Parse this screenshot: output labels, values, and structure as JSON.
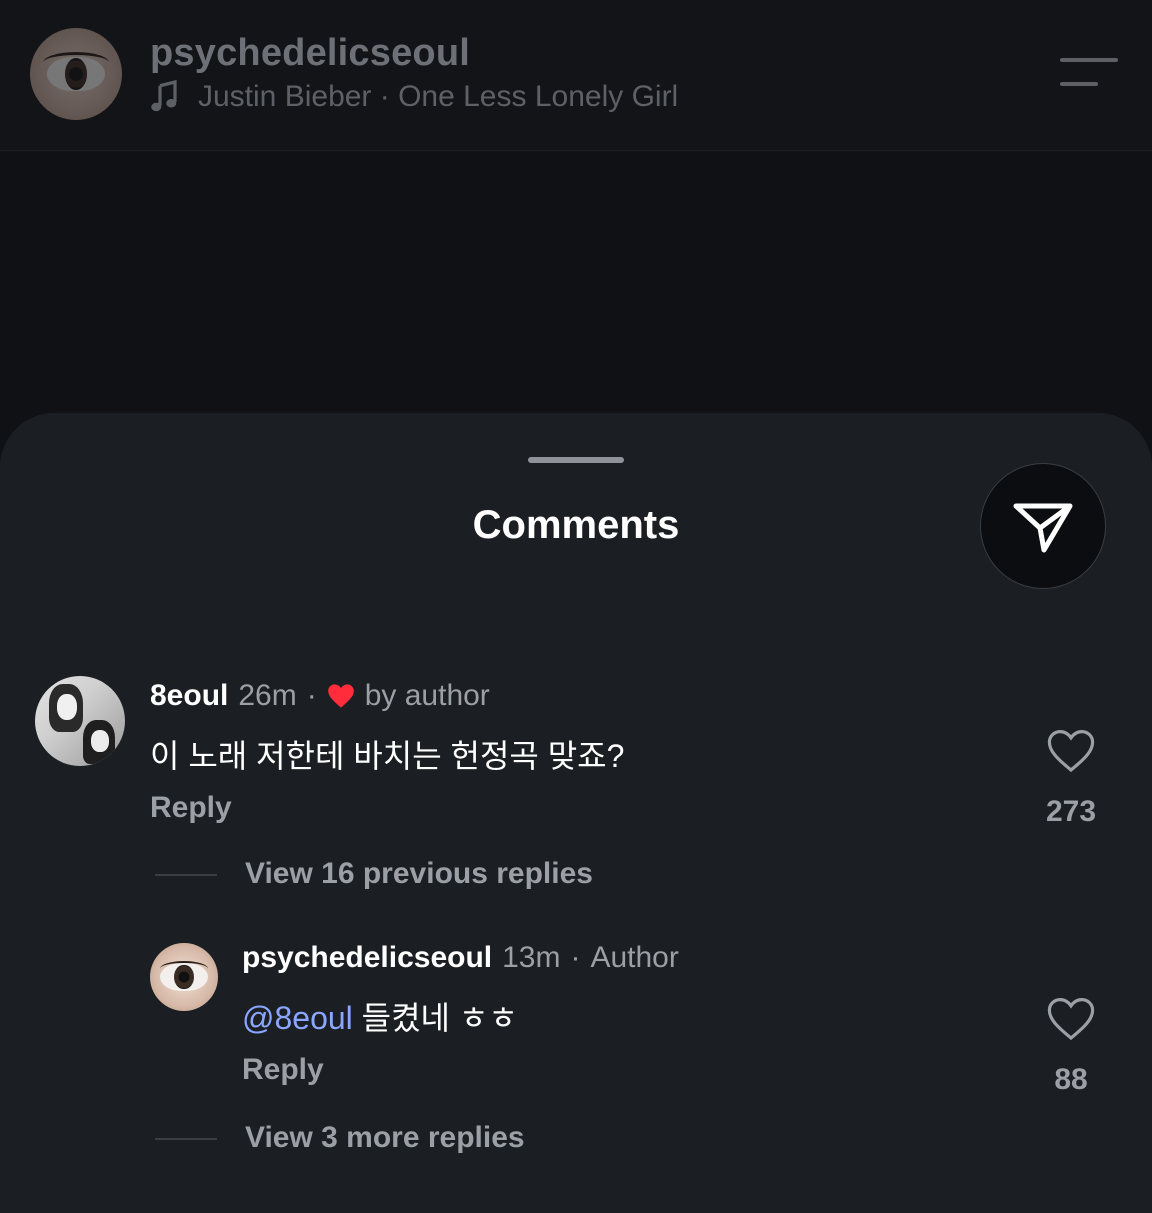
{
  "header": {
    "username": "psychedelicseoul",
    "song": "Justin Bieber · One Less Lonely Girl",
    "avatar_icon": "eye-avatar-icon",
    "music_icon": "music-note-icon",
    "menu_icon": "hamburger-menu-icon"
  },
  "sheet": {
    "title": "Comments",
    "share_icon": "send-icon"
  },
  "comments": [
    {
      "username": "8eoul",
      "time": "26m",
      "liked_by": "by author",
      "text": "이 노래 저한테 바치는 헌정곡 맞죠?",
      "reply_label": "Reply",
      "likes": "273",
      "view_replies": "View 16 previous replies"
    },
    {
      "username": "psychedelicseoul",
      "time": "13m",
      "badge": "Author",
      "mention": "@8eoul",
      "text": " 들켰네 ㅎㅎ",
      "reply_label": "Reply",
      "likes": "88",
      "view_replies": "View 3 more replies"
    }
  ],
  "colors": {
    "background": "#0f1114",
    "sheet": "#1b1e22",
    "mention": "#8aa6ff",
    "heart": "#ff2d3b",
    "secondary_text": "#9aa0a6"
  }
}
